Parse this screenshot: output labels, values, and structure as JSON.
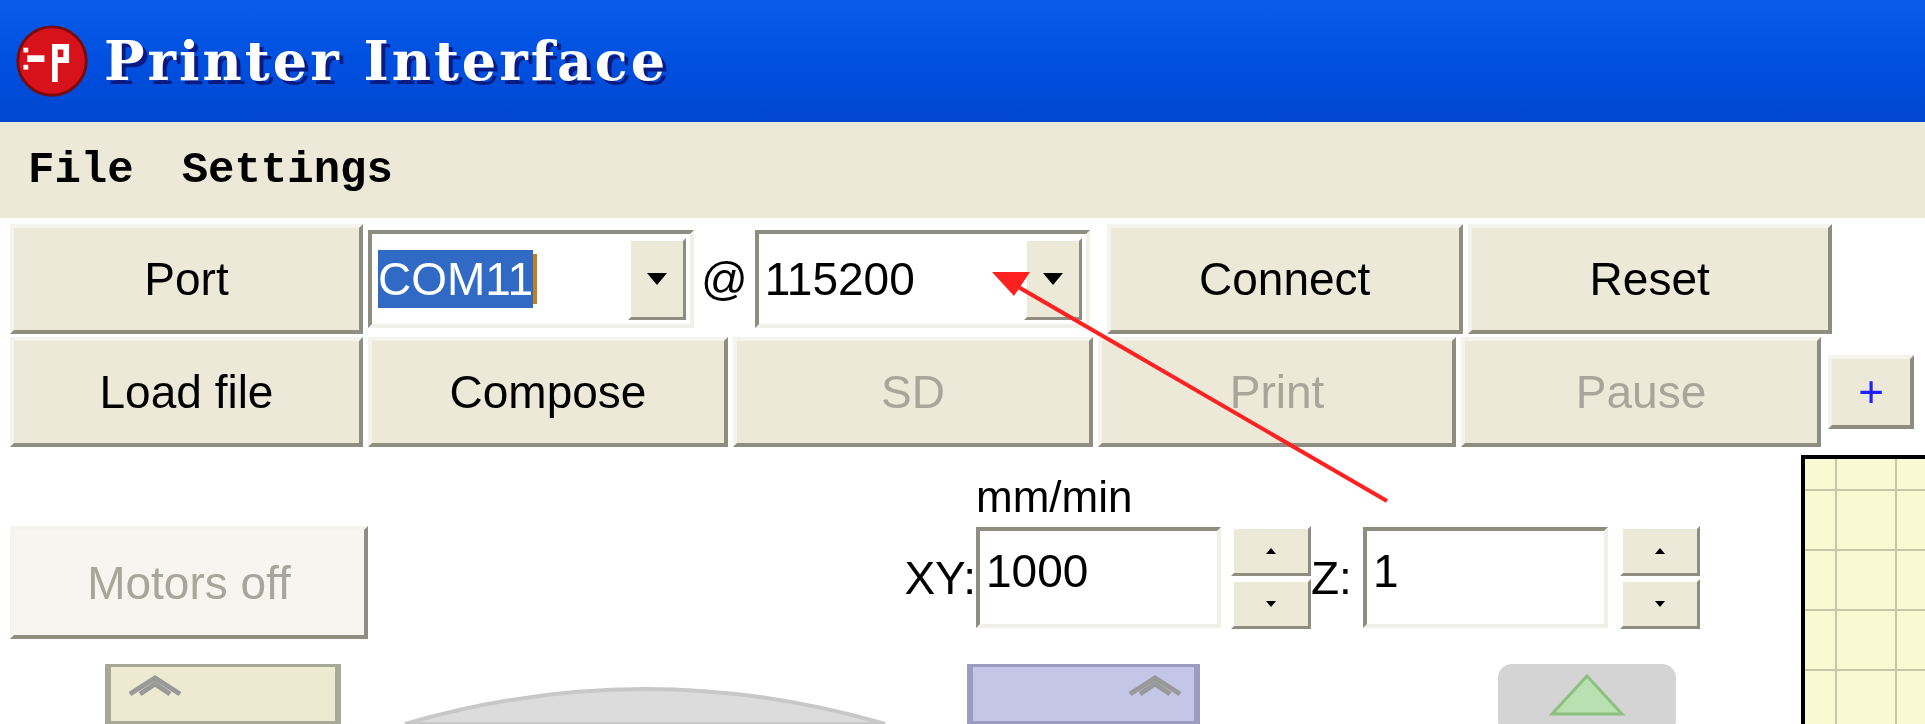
{
  "window": {
    "title": "Printer Interface"
  },
  "menu": [
    {
      "label": "File"
    },
    {
      "label": "Settings"
    }
  ],
  "connection_bar": {
    "port_button": "Port",
    "port": {
      "value": "COM11",
      "selected": true
    },
    "separator": "@",
    "baud": {
      "value": "115200",
      "selected": false
    },
    "connect_button": "Connect",
    "reset_button": "Reset"
  },
  "action_bar": [
    {
      "label": "Load file",
      "disabled": false
    },
    {
      "label": "Compose",
      "disabled": false
    },
    {
      "label": "SD",
      "disabled": true
    },
    {
      "label": "Print",
      "disabled": true
    },
    {
      "label": "Pause",
      "disabled": true
    }
  ],
  "add_button": "+",
  "motors_off": {
    "label": "Motors off",
    "disabled": true
  },
  "feedrate": {
    "unit": "mm/min",
    "xy_label": "XY:",
    "xy_value": "1000",
    "z_label": "Z:",
    "z_value": "1"
  }
}
